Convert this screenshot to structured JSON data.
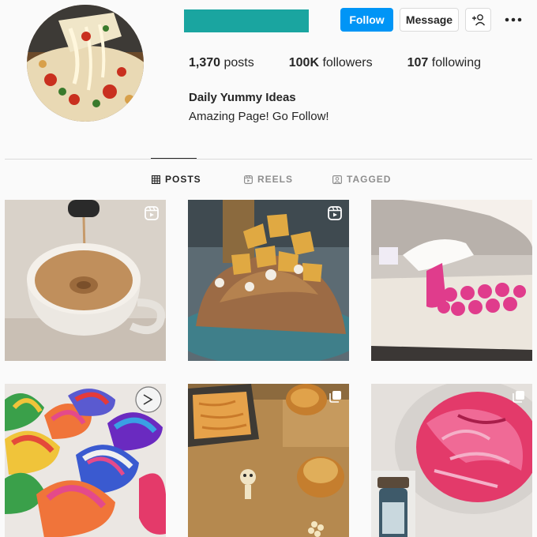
{
  "profile": {
    "full_name": "Daily Yummy Ideas",
    "bio": "Amazing Page! Go Follow!",
    "username_redaction_color": "#1aa5a0"
  },
  "actions": {
    "follow_label": "Follow",
    "message_label": "Message",
    "suggest_icon": "person-plus-icon",
    "more_icon": "more-dots-icon",
    "follow_color": "#0095f6"
  },
  "stats": {
    "posts_count": "1,370",
    "posts_label": "posts",
    "followers_count": "100K",
    "followers_label": "followers",
    "following_count": "107",
    "following_label": "following"
  },
  "tabs": [
    {
      "label": "POSTS",
      "icon": "grid-icon",
      "active": true
    },
    {
      "label": "REELS",
      "icon": "reels-icon",
      "active": false
    },
    {
      "label": "TAGGED",
      "icon": "tagged-icon",
      "active": false
    }
  ],
  "posts": [
    {
      "subject": "coffee cup",
      "badge": "reel-icon"
    },
    {
      "subject": "cornflake chocolate",
      "badge": "reel-icon"
    },
    {
      "subject": "pink macarons",
      "badge": "none"
    },
    {
      "subject": "rainbow meringues",
      "badge": "none"
    },
    {
      "subject": "madeleines",
      "badge": "multi-post-icon"
    },
    {
      "subject": "pink frosting bowl",
      "badge": "multi-post-icon"
    }
  ]
}
